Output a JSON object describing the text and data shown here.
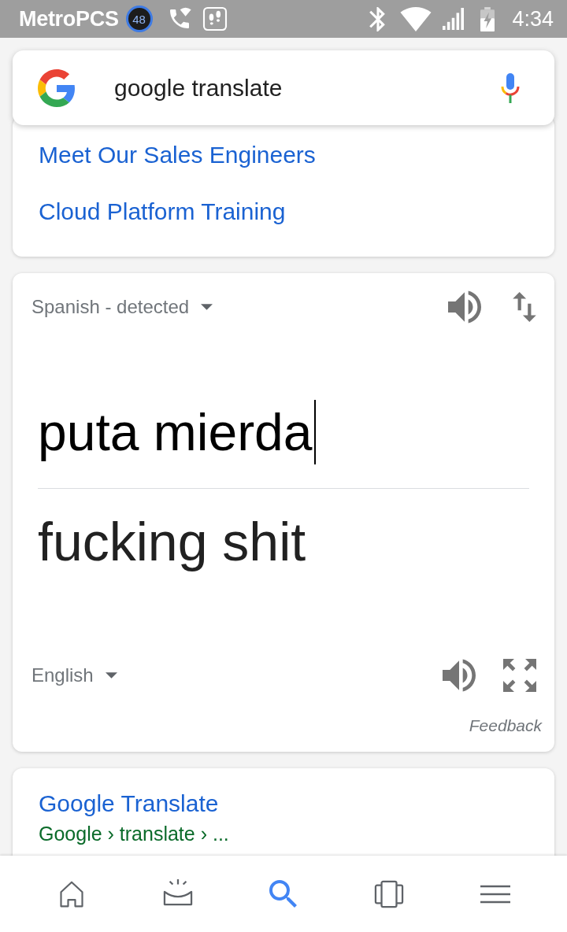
{
  "status_bar": {
    "carrier": "MetroPCS",
    "notification_count": "48",
    "time": "4:34"
  },
  "search": {
    "query": "google translate"
  },
  "links": [
    {
      "label": "Meet Our Sales Engineers"
    },
    {
      "label": "Cloud Platform Training"
    }
  ],
  "translator": {
    "source_language": "Spanish - detected",
    "source_text": "puta mierda",
    "translation": "fucking shit",
    "target_language": "English",
    "feedback": "Feedback"
  },
  "result": {
    "title": "Google Translate",
    "breadcrumb": "Google › translate › ..."
  },
  "bottom_nav": [
    {
      "kind": "home",
      "selected": false
    },
    {
      "kind": "updates",
      "selected": false
    },
    {
      "kind": "search",
      "selected": true
    },
    {
      "kind": "tabs",
      "selected": false
    },
    {
      "kind": "menu",
      "selected": false
    }
  ]
}
